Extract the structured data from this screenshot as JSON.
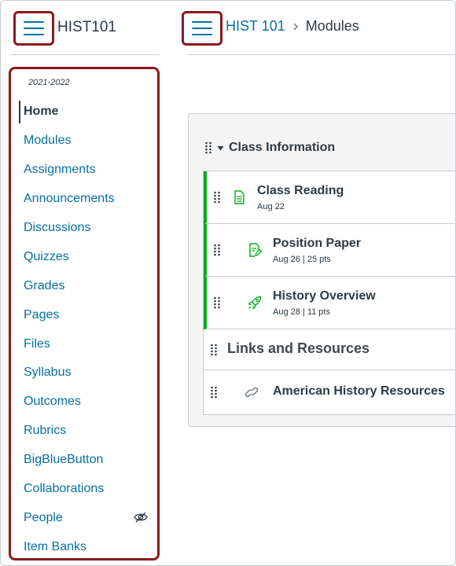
{
  "header": {
    "course_code": "HIST101",
    "breadcrumb": {
      "course_link": "HIST 101",
      "current": "Modules"
    }
  },
  "sidebar": {
    "term": "2021-2022",
    "items": [
      {
        "label": "Home",
        "active": true
      },
      {
        "label": "Modules"
      },
      {
        "label": "Assignments"
      },
      {
        "label": "Announcements"
      },
      {
        "label": "Discussions"
      },
      {
        "label": "Quizzes"
      },
      {
        "label": "Grades"
      },
      {
        "label": "Pages"
      },
      {
        "label": "Files"
      },
      {
        "label": "Syllabus"
      },
      {
        "label": "Outcomes"
      },
      {
        "label": "Rubrics"
      },
      {
        "label": "BigBlueButton"
      },
      {
        "label": "Collaborations"
      },
      {
        "label": "People",
        "icon": "eye-slash-icon"
      },
      {
        "label": "Item Banks"
      }
    ]
  },
  "module": {
    "title": "Class Information",
    "items": [
      {
        "title": "Class Reading",
        "meta": "Aug 22",
        "icon": "page-icon"
      },
      {
        "title": "Position Paper",
        "meta": "Aug 26  |  25 pts",
        "icon": "assignment-icon"
      },
      {
        "title": "History Overview",
        "meta": "Aug 28  |  11 pts",
        "icon": "quiz-rocket-icon"
      }
    ],
    "subheader": "Links and Resources",
    "link_item": {
      "title": "American History Resources",
      "icon": "link-icon"
    }
  },
  "colors": {
    "link": "#0770a3",
    "text": "#2d3b45",
    "highlight": "#8b1a1a",
    "published": "#00ac18"
  }
}
